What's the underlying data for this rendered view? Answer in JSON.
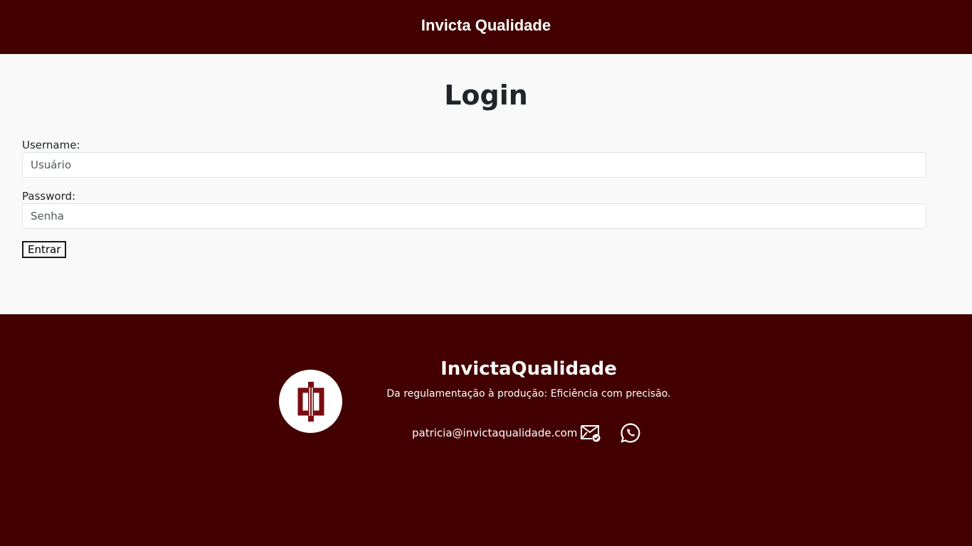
{
  "header": {
    "brand": "Invicta Qualidade"
  },
  "login": {
    "title": "Login",
    "username_label": "Username:",
    "username_placeholder": "Usuário",
    "password_label": "Password:",
    "password_placeholder": "Senha",
    "submit_label": "Entrar"
  },
  "footer": {
    "brand": "InvictaQualidade",
    "tagline": "Da regulamentação à produção: Eficiência com precisão.",
    "email": "patricia@invictaqualidade.com",
    "icons": {
      "logo": "invicta-logo",
      "mail": "mail-check-icon",
      "whatsapp": "whatsapp-icon"
    }
  },
  "colors": {
    "brand_dark_red": "#430000",
    "content_bg": "#f9f9f9",
    "text": "#212529"
  }
}
